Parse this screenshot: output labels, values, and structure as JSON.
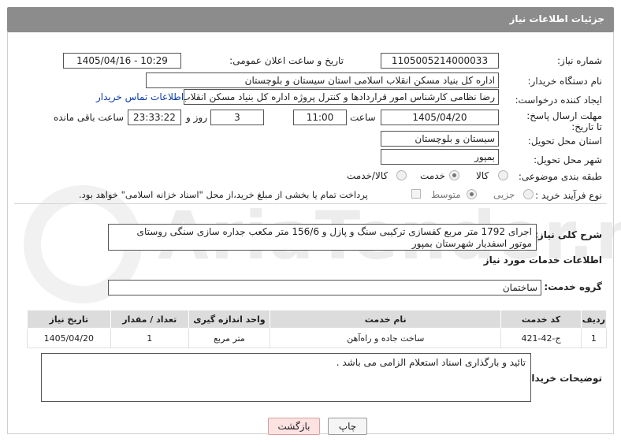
{
  "header": {
    "title": "جزئیات اطلاعات نیاز"
  },
  "form": {
    "need_number_label": "شماره نیاز:",
    "need_number": "1105005214000033",
    "announce_label": "تاریخ و ساعت اعلان عمومی:",
    "announce_value": "1405/04/16 - 10:29",
    "buyer_label": "نام دستگاه خریدار:",
    "buyer_value": "اداره کل بنیاد مسکن انقلاب اسلامی استان سیستان و بلوچستان",
    "creator_label": "ایجاد کننده درخواست:",
    "creator_value": "رضا نظامی کارشناس امور قراردادها و کنترل پروژه اداره کل بنیاد مسکن انقلاب اس",
    "contact_link": "اطلاعات تماس خریدار",
    "deadline_label": "مهلت ارسال پاسخ: تا تاریخ:",
    "deadline_date": "1405/04/20",
    "time_label": "ساعت",
    "deadline_time": "11:00",
    "days_value": "3",
    "days_label": "روز و",
    "remaining_time": "23:33:22",
    "remaining_label": "ساعت باقی مانده",
    "province_label": "استان محل تحویل:",
    "province_value": "سیستان و بلوچستان",
    "city_label": "شهر محل تحویل:",
    "city_value": "بمپور",
    "category_label": "طبقه بندی موضوعی:",
    "category_options": [
      "کالا",
      "خدمت",
      "کالا/خدمت"
    ],
    "category_selected": "خدمت",
    "process_label": "نوع فرآیند خرید :",
    "process_options": [
      "جزیی",
      "متوسط"
    ],
    "process_selected": "متوسط",
    "payment_text": "پرداخت تمام یا بخشی از مبلغ خرید،از محل \"اسناد خزانه اسلامی\" خواهد بود."
  },
  "summary": {
    "label": "شرح کلی نیاز:",
    "text": "اجرای 1792 متر مربع کفسازی ترکیبی سنگ و پازل و 156/6 متر مکعب جداره سازی سنگی روستای موتور اسفدیار شهرستان بمپور"
  },
  "services": {
    "section_title": "اطلاعات خدمات مورد نیاز",
    "group_label": "گروه خدمت:",
    "group_value": "ساختمان",
    "columns": [
      "ردیف",
      "کد خدمت",
      "نام خدمت",
      "واحد اندازه گیری",
      "تعداد / مقدار",
      "تاریخ نیاز"
    ],
    "rows": [
      {
        "row": "1",
        "code": "ج-42-421",
        "name": "ساخت جاده و راه‌آهن",
        "unit": "متر مربع",
        "qty": "1",
        "date": "1405/04/20"
      }
    ]
  },
  "buyer_notes": {
    "label": "توضیحات خریدار:",
    "text": "تائید و بارگذاری اسناد استعلام الزامی می باشد ."
  },
  "buttons": {
    "print": "چاپ",
    "back": "بازگشت"
  },
  "watermark": "AriaTender.net",
  "colors": {
    "titlebar": "#8c8c8c",
    "link": "#0a3da8",
    "back_button": "#fde2e2"
  }
}
